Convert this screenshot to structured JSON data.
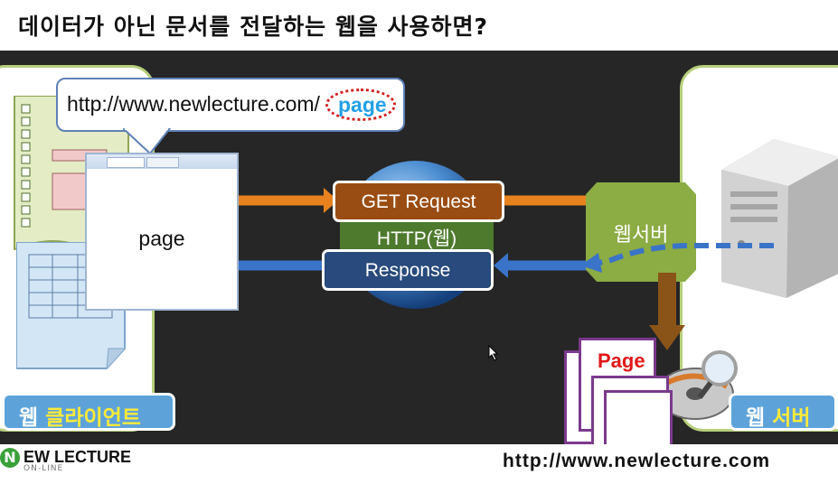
{
  "title": "데이터가 아닌 문서를 전달하는 웹을 사용하면?",
  "url_bubble": {
    "prefix": "http://www.newlecture.com/",
    "highlight": "page"
  },
  "browser_page_label": "page",
  "request_label": "GET Request",
  "protocol_label": "HTTP(웹)",
  "response_label": "Response",
  "web_server_box_label": "웹서버",
  "document_label": "Page",
  "client_label": {
    "prefix": "웹 ",
    "highlight": "클라이언트"
  },
  "server_label": {
    "prefix": "웹 ",
    "highlight": "서버"
  },
  "footer": {
    "logo_text": "EW LECTURE",
    "logo_sub": "ON-LINE",
    "url": "http://www.newlecture.com"
  },
  "colors": {
    "stage_bg": "#262626",
    "request_box": "#9a4d12",
    "response_box": "#284a7c",
    "request_arrow": "#e8821e",
    "response_arrow": "#3a74c8",
    "server_box": "#8cac44",
    "label_blue": "#5da3da",
    "highlight_yellow": "#ffea3a",
    "url_highlight": "#23a0e6"
  },
  "icons": [
    "form-document-icon",
    "spreadsheet-document-icon",
    "globe-icon",
    "server-tower-icon",
    "cd-disk-icon",
    "magnifier-icon",
    "mouse-cursor-icon"
  ]
}
